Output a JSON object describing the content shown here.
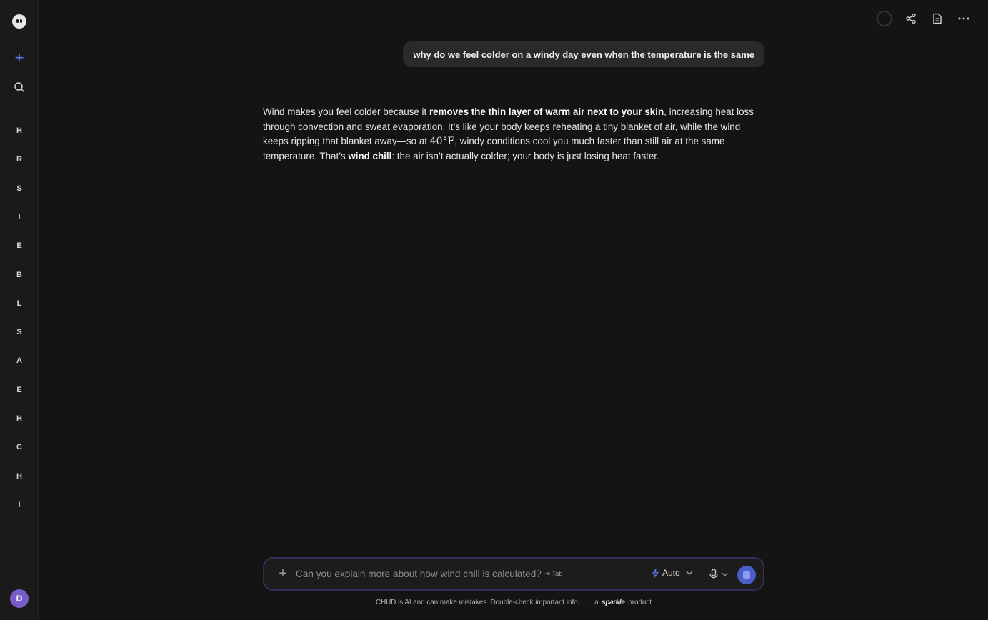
{
  "sidebar": {
    "logo_icon": "ghost-logo-icon",
    "new_chat_icon": "plus-icon",
    "search_icon": "search-icon",
    "items": [
      {
        "label": "H"
      },
      {
        "label": "R"
      },
      {
        "label": "S"
      },
      {
        "label": "I"
      },
      {
        "label": "E"
      },
      {
        "label": "B"
      },
      {
        "label": "L"
      },
      {
        "label": "S"
      },
      {
        "label": "A"
      },
      {
        "label": "E"
      },
      {
        "label": "H"
      },
      {
        "label": "C"
      },
      {
        "label": "H"
      },
      {
        "label": "I"
      }
    ],
    "avatar_letter": "D"
  },
  "header": {
    "actions": [
      "status-ring-icon",
      "share-icon",
      "document-icon",
      "more-icon"
    ]
  },
  "conversation": {
    "user_message": "why do we feel colder on a windy day even when the temperature is the same",
    "answer": {
      "p1": "Wind makes you feel colder because it ",
      "b1": "removes the thin layer of warm air next to your skin",
      "p2": ", increasing heat loss through convection and sweat evaporation. It’s like your body keeps reheating a tiny blanket of air, while the wind keeps ripping that blanket away—so at ",
      "math": "40°F",
      "p3": ", windy conditions cool you much faster than still air at the same temperature. That’s ",
      "b2": "wind chill",
      "p4": ": the air isn’t actually colder; your body is just losing heat faster."
    }
  },
  "composer": {
    "suggestion": "Can you explain more about how wind chill is calculated?",
    "tab_hint": "⇥ Tab",
    "mode_label": "Auto",
    "mode_icon": "bolt-icon",
    "mic_icon": "microphone-icon",
    "send_icon": "stop-icon"
  },
  "footer": {
    "disclaimer": "CHUD is AI and can make mistakes. Double-check important info.",
    "separator": "·",
    "prefix": "a",
    "brand": "sparkle",
    "suffix": "product"
  },
  "colors": {
    "background": "#141414",
    "sidebar": "#1a1a1a",
    "accent": "#5b7cf0",
    "avatar": "#7a5cc9",
    "send": "#4a5ec9"
  }
}
